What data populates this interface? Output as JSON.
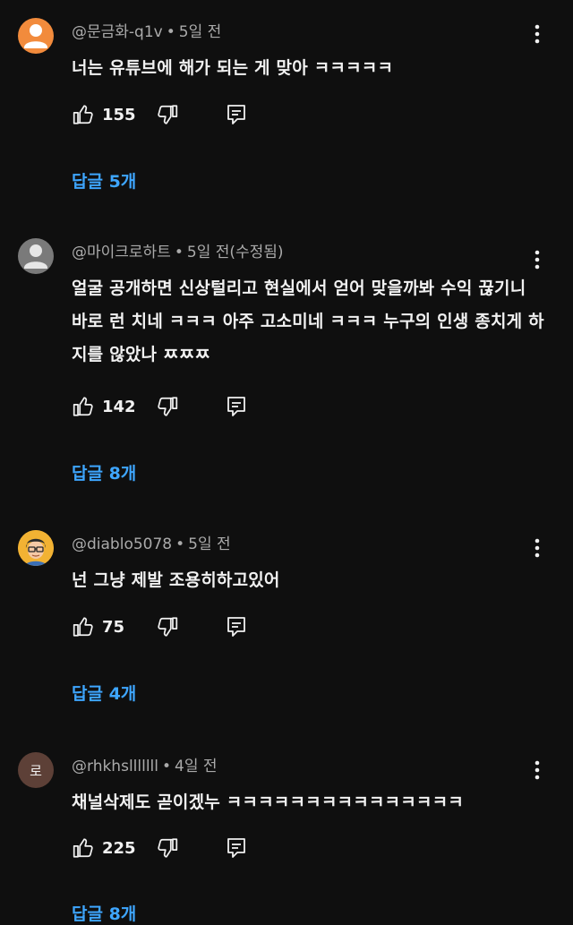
{
  "comments": [
    {
      "author": "@문금화-q1v",
      "time": "5일 전",
      "text": "너는 유튜브에 해가 되는 게 맞아 ㅋㅋㅋㅋㅋ",
      "likes": "155",
      "replies": "답글 5개",
      "avatar": {
        "type": "default-person-icon",
        "color": "#f28b3c"
      }
    },
    {
      "author": "@마이크로하트",
      "time": "5일 전(수정됨)",
      "text": "얼굴 공개하면 신상털리고 현실에서 얻어 맞을까봐 수익 끊기니 바로 런 치네 ㅋㅋㅋ 아주 고소미네 ㅋㅋㅋ 누구의 인생 종치게 하지를 않았나 ㅉㅉㅉ",
      "likes": "142",
      "replies": "답글 8개",
      "avatar": {
        "type": "default-person-icon",
        "color": "#7a7a7a"
      }
    },
    {
      "author": "@diablo5078",
      "time": "5일 전",
      "text": "넌 그냥 제발 조용히하고있어",
      "likes": "75",
      "replies": "답글 4개",
      "avatar": {
        "type": "cartoon-face-icon",
        "color": "#f2b233"
      }
    },
    {
      "author": "@rhkhslllllll",
      "time": "4일 전",
      "text": "채널삭제도 곧이겠누 ㅋㅋㅋㅋㅋㅋㅋㅋㅋㅋㅋㅋㅋㅋㅋ",
      "likes": "225",
      "replies": "답글 8개",
      "avatar": {
        "type": "letter",
        "letter": "로",
        "color": "#5d4037"
      }
    }
  ]
}
